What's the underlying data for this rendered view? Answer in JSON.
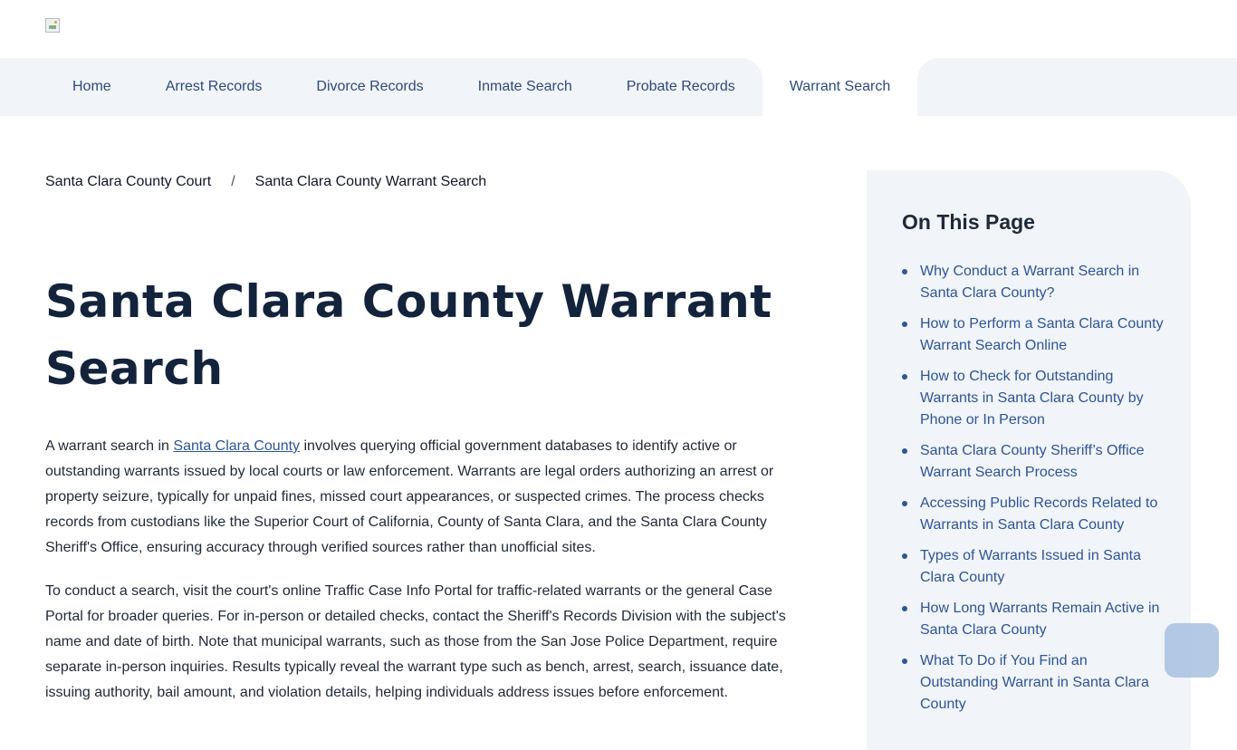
{
  "nav": {
    "items": [
      {
        "label": "Home"
      },
      {
        "label": "Arrest Records"
      },
      {
        "label": "Divorce Records"
      },
      {
        "label": "Inmate Search"
      },
      {
        "label": "Probate Records"
      },
      {
        "label": "Warrant Search"
      }
    ]
  },
  "breadcrumb": {
    "parent": "Santa Clara County Court",
    "separator": "/",
    "current": "Santa Clara County Warrant Search"
  },
  "page": {
    "title": "Santa Clara County Warrant Search"
  },
  "content": {
    "p1_before": "A warrant search in ",
    "p1_link": "Santa Clara County",
    "p1_after": " involves querying official government databases to identify active or outstanding warrants issued by local courts or law enforcement. Warrants are legal orders authorizing an arrest or property seizure, typically for unpaid fines, missed court appearances, or suspected crimes. The process checks records from custodians like the Superior Court of California, County of Santa Clara, and the Santa Clara County Sheriff's Office, ensuring accuracy through verified sources rather than unofficial sites.",
    "p2": "To conduct a search, visit the court's online Traffic Case Info Portal for traffic-related warrants or the general Case Portal for broader queries. For in-person or detailed checks, contact the Sheriff's Records Division with the subject's name and date of birth. Note that municipal warrants, such as those from the San Jose Police Department, require separate in-person inquiries. Results typically reveal the warrant type such as bench, arrest, search, issuance date, issuing authority, bail amount, and violation details, helping individuals address issues before enforcement."
  },
  "toc": {
    "heading": "On This Page",
    "items": [
      "Why Conduct a Warrant Search in Santa Clara County?",
      "How to Perform a Santa Clara County Warrant Search Online",
      "How to Check for Outstanding Warrants in Santa Clara County by Phone or In Person",
      "Santa Clara County Sheriff’s Office Warrant Search Process",
      "Accessing Public Records Related to Warrants in Santa Clara County",
      "Types of Warrants Issued in Santa Clara County",
      "How Long Warrants Remain Active in Santa Clara County",
      "What To Do if You Find an Outstanding Warrant in Santa Clara County"
    ]
  },
  "colors": {
    "nav_bg": "#f1f4f8",
    "link": "#2e5597",
    "title": "#14233c"
  },
  "icons": {
    "logo": "broken-image-icon",
    "float_button": "scroll-to-top-button"
  }
}
